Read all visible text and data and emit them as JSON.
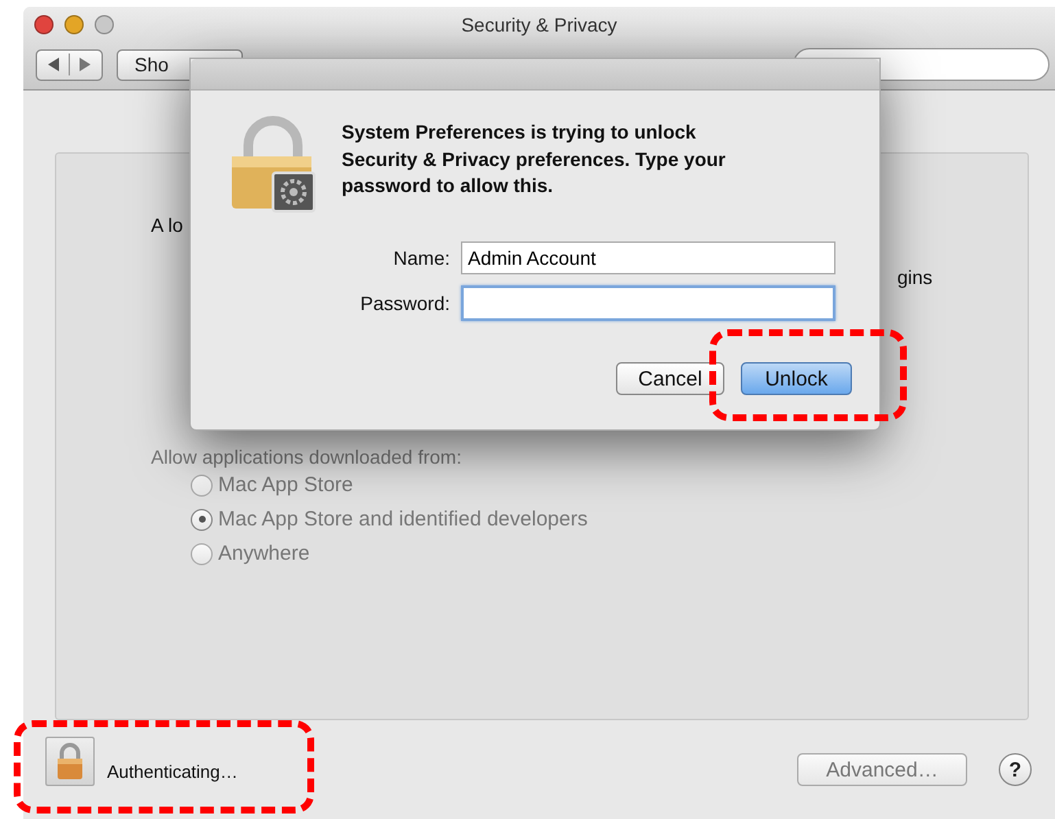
{
  "window": {
    "title": "Security & Privacy"
  },
  "toolbar": {
    "show_all_button": "Sho"
  },
  "panel": {
    "text_left": "A lo",
    "text_right": "gins",
    "gatekeeper": {
      "label": "Allow applications downloaded from:",
      "disabled": true,
      "options": [
        {
          "label": "Mac App Store",
          "selected": false
        },
        {
          "label": "Mac App Store and identified developers",
          "selected": true
        },
        {
          "label": "Anywhere",
          "selected": false
        }
      ]
    }
  },
  "footer": {
    "lock_status": "Authenticating…",
    "advanced_button": "Advanced…",
    "help_button": "?"
  },
  "dialog": {
    "message": "System Preferences is trying to unlock Security & Privacy preferences. Type your password to allow this.",
    "fields": [
      {
        "label": "Name:",
        "value": "Admin Account",
        "focused": false
      },
      {
        "label": "Password:",
        "focused": true
      }
    ],
    "buttons": [
      {
        "label": "Cancel",
        "default": false
      },
      {
        "label": "Unlock",
        "default": true
      }
    ]
  }
}
